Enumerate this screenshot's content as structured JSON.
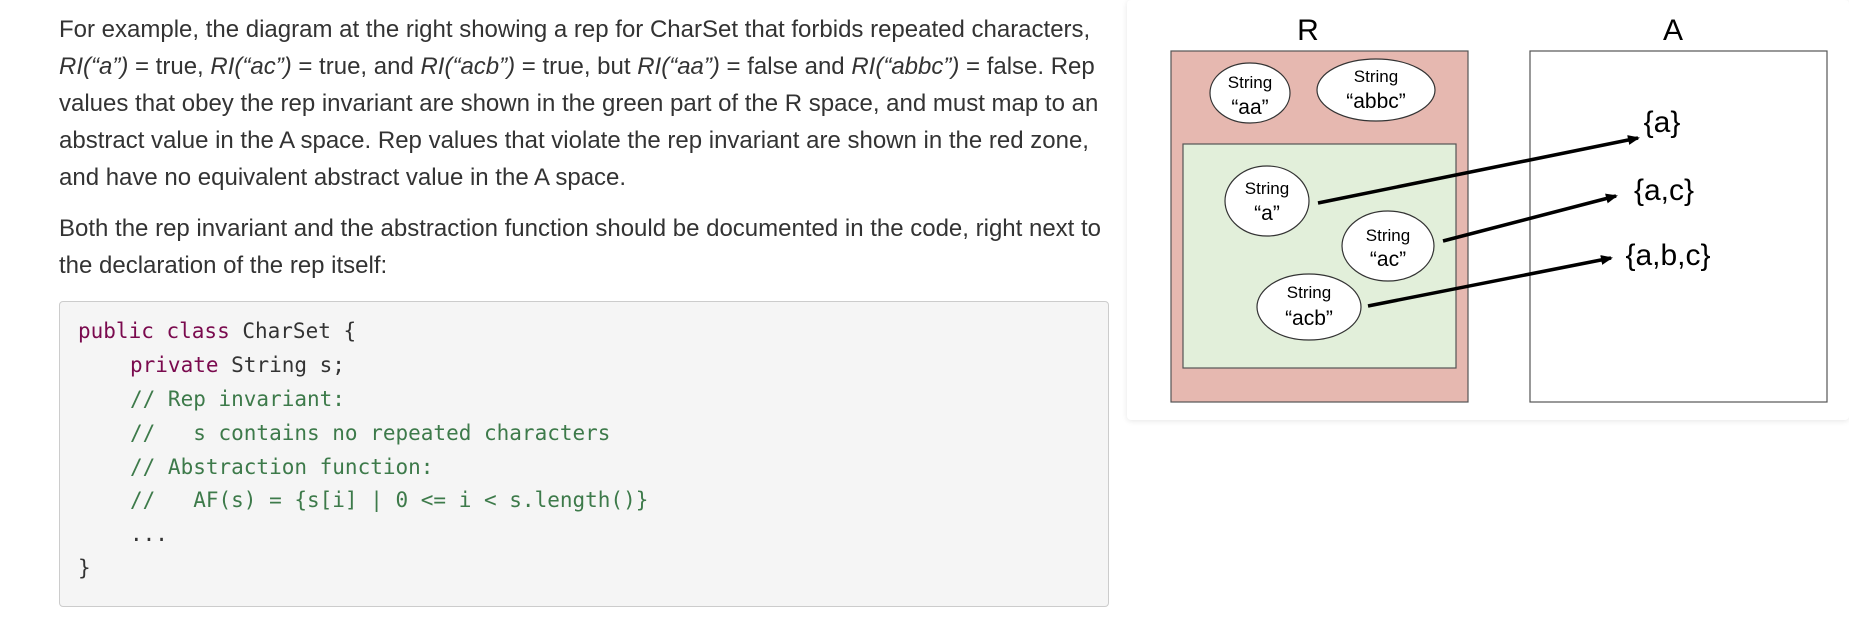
{
  "paragraph1": {
    "t1": "For example, the diagram at the right showing a rep for CharSet that forbids repeated characters, ",
    "ri_a": "RI(“a”)",
    "t2": " = true, ",
    "ri_ac": "RI(“ac”)",
    "t3": " = true, and ",
    "ri_acb": "RI(“acb”)",
    "t4": " = true, but ",
    "ri_aa": "RI(“aa”)",
    "t5": " = false and ",
    "ri_abbc": "RI(“abbc”)",
    "t6": " = false. Rep values that obey the rep invariant are shown in the green part of the R space, and must map to an abstract value in the A space. Rep values that violate the rep invariant are shown in the red zone, and have no equivalent abstract value in the A space."
  },
  "paragraph2": {
    "text": "Both the rep invariant and the abstraction function should be documented in the code, right next to the declaration of the rep itself:"
  },
  "code": {
    "line1_kw": "public class",
    "line1_rest": " CharSet {",
    "line2_kw": "private",
    "line2_rest": " String s;",
    "line3": "// Rep invariant:",
    "line4": "//   s contains no repeated characters",
    "line5": "// Abstraction function:",
    "line6": "//   AF(s) = {s[i] | 0 <= i < s.length()}",
    "line7": "...",
    "line8": "}"
  },
  "diagram": {
    "label_r": "R",
    "label_a": "A",
    "colors": {
      "red_zone": "#e6b8b0",
      "green_zone": "#e2efda",
      "border": "#555555"
    },
    "reps": [
      {
        "type": "String",
        "value": "“aa”"
      },
      {
        "type": "String",
        "value": "“abbc”"
      },
      {
        "type": "String",
        "value": "“a”"
      },
      {
        "type": "String",
        "value": "“ac”"
      },
      {
        "type": "String",
        "value": "“acb”"
      }
    ],
    "abstract_values": [
      "{a}",
      "{a,c}",
      "{a,b,c}"
    ]
  }
}
